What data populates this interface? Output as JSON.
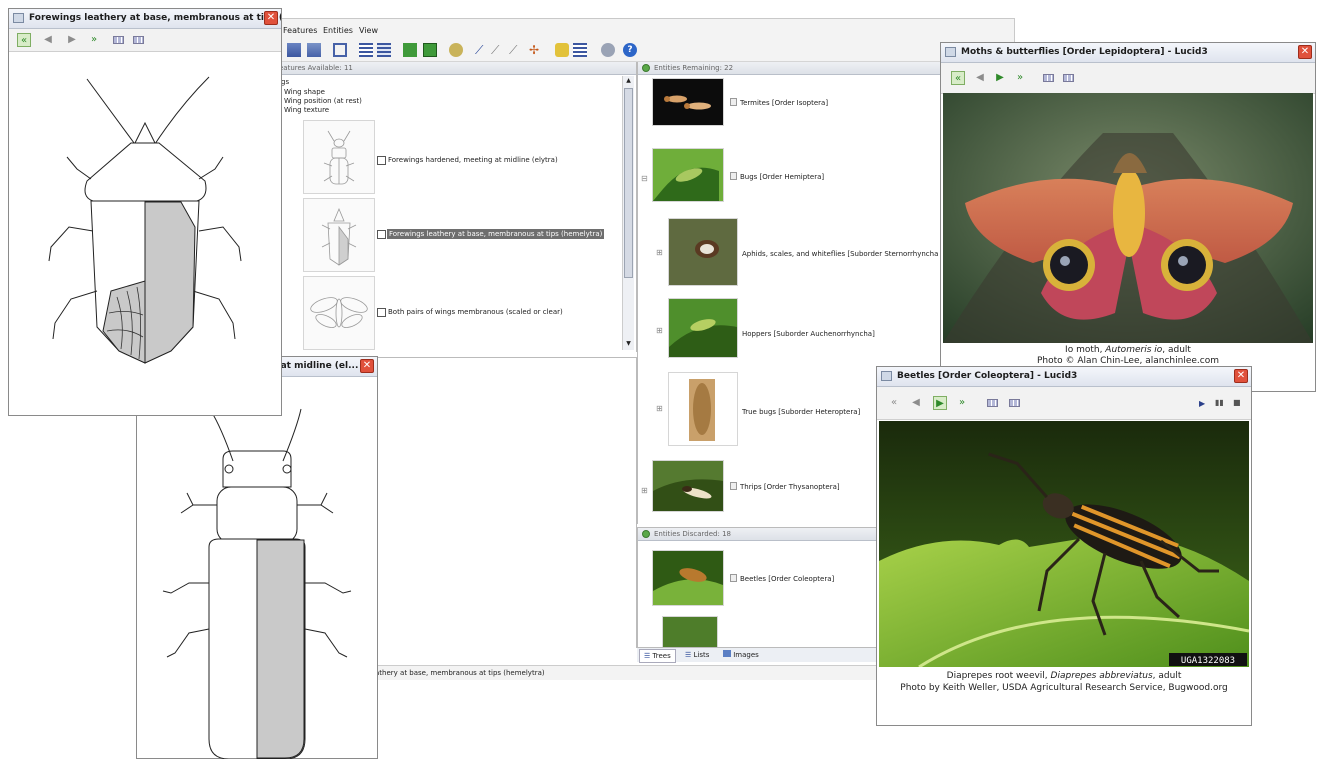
{
  "menu": {
    "items": [
      "Features",
      "Entities",
      "View"
    ]
  },
  "features": {
    "header": "eatures Available: 11",
    "tree": [
      "gs",
      "Wing shape",
      "Wing position (at rest)",
      "Wing texture"
    ],
    "states": [
      "Forewings hardened, meeting at midline (elytra)",
      "Forewings leathery at base, membranous at tips (hemelytra)",
      "Both pairs of wings membranous (scaled or clear)"
    ]
  },
  "entities": {
    "remaining_header": "Entities Remaining: 22",
    "remaining": [
      "Termites [Order Isoptera]",
      "Bugs [Order Hemiptera]",
      "Aphids, scales, and whiteflies [Suborder Sternorrhyncha",
      "Hoppers [Suborder Auchenorrhyncha]",
      "True bugs [Suborder Heteroptera]",
      "Thrips [Order Thysanoptera]"
    ],
    "discarded_header": "Entities Discarded: 18",
    "discarded": [
      "Beetles [Order Coleoptera]"
    ],
    "tabs": [
      "Trees",
      "Lists",
      "Images"
    ]
  },
  "status": {
    "text": "athery at base, membranous at tips (hemelytra)"
  },
  "win_hemelytra": {
    "title": "Forewings leathery at base, membranous at tips (h..."
  },
  "win_elytra": {
    "title": "g at midline (el..."
  },
  "win_moth": {
    "title": "Moths & butterflies [Order Lepidoptera] - Lucid3",
    "caption_a": "Io moth, ",
    "caption_b": "Automeris io",
    "caption_c": ", adult",
    "credit": "Photo © Alan Chin-Lee, alanchinlee.com"
  },
  "win_beetle": {
    "title": "Beetles [Order Coleoptera] - Lucid3",
    "caption_a": "Diaprepes root weevil, ",
    "caption_b": "Diaprepes abbreviatus",
    "caption_c": ", adult",
    "credit": "Photo by Keith Weller, USDA Agricultural Research Service, Bugwood.org",
    "watermark": "UGA1322083"
  },
  "icons": {
    "first": "first-icon",
    "prev": "previous-icon",
    "next": "next-icon",
    "last": "last-icon",
    "grid": "thumbnail-grid-icon",
    "export": "export-icon",
    "close": "close-icon",
    "help": "help-icon"
  },
  "colors": {
    "close": "#e0513c",
    "nav_green": "#2f8a2a",
    "selection": "#6e6e6e",
    "panel_dot": "#5aa848"
  }
}
